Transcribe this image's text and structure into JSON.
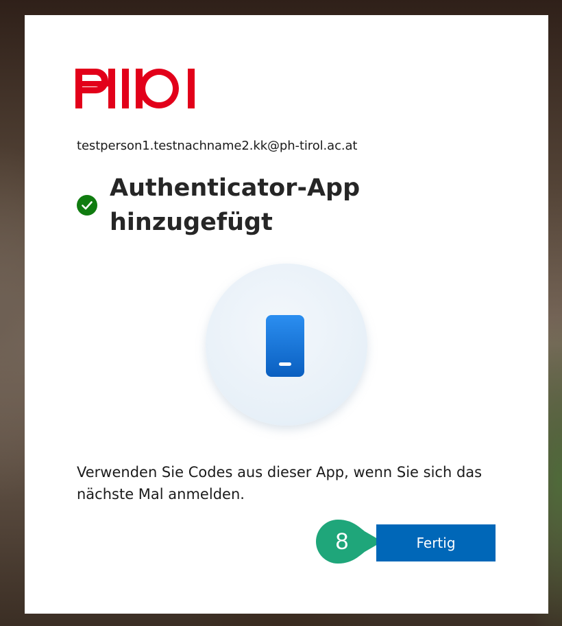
{
  "brand": {
    "logo_text": "PH TIROL",
    "logo_color": "#e2001a"
  },
  "account": {
    "email": "testperson1.testnachname2.kk@ph-tirol.ac.at"
  },
  "status": {
    "icon": "check-circle-icon",
    "color": "#107c10",
    "title": "Authenticator-App hinzugefügt"
  },
  "illustration": {
    "icon": "mobile-phone-icon",
    "accent": "#0078d4"
  },
  "description": "Verwenden Sie Codes aus dieser App, wenn Sie sich das nächste Mal anmelden.",
  "callout": {
    "number": "8",
    "color": "#1fa67a"
  },
  "actions": {
    "done_label": "Fertig",
    "button_color": "#0067b8"
  }
}
